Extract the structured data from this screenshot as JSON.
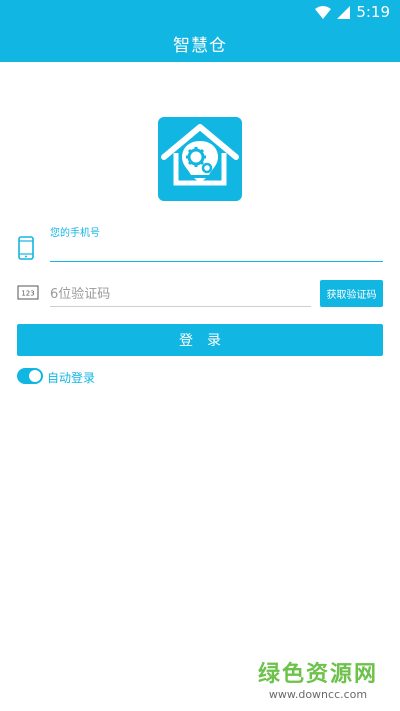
{
  "status_bar": {
    "time": "5:19",
    "wifi_icon": "wifi-icon",
    "signal_icon": "signal-icon"
  },
  "header": {
    "title": "智慧仓"
  },
  "logo": {
    "icon": "house-bulb-gear-logo"
  },
  "form": {
    "phone_label": "您的手机号",
    "phone_value": "",
    "phone_icon": "phone-icon",
    "code_placeholder": "6位验证码",
    "code_value": "",
    "code_icon": "code-123-icon",
    "get_code_label": "获取验证码",
    "login_label": "登录",
    "auto_login_label": "自动登录",
    "auto_login_enabled": true
  },
  "watermark": {
    "title": "绿色资源网",
    "url": "www.downcc.com"
  },
  "colors": {
    "accent": "#12B6E3",
    "watermark_green": "#6CC24A"
  }
}
